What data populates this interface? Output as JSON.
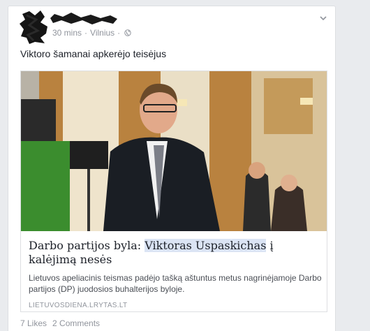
{
  "post": {
    "time": "30 mins",
    "separator": "·",
    "location": "Vilnius",
    "status_text": "Viktoro šamanai apkerėjo teisėjus"
  },
  "link": {
    "title_before": "Darbo partijos byla: ",
    "title_highlight": "Viktoras Uspaskichas",
    "title_after": " į kalėjimą nesės",
    "description": "Lietuvos apeliacinis teismas padėjo tašką aštuntus metus nagrinėjamoje Darbo partijos (DP) juodosios buhalterijos byloje.",
    "domain": "LIETUVOSDIENA.LRYTAS.LT"
  },
  "footer": {
    "likes": "7 Likes",
    "comments": "2 Comments"
  },
  "icons": {
    "privacy": "globe-icon",
    "options": "chevron-down-icon"
  },
  "colors": {
    "background": "#e9ebee",
    "text": "#1d2129",
    "muted": "#90949c",
    "highlight": "#dbe4f4"
  }
}
